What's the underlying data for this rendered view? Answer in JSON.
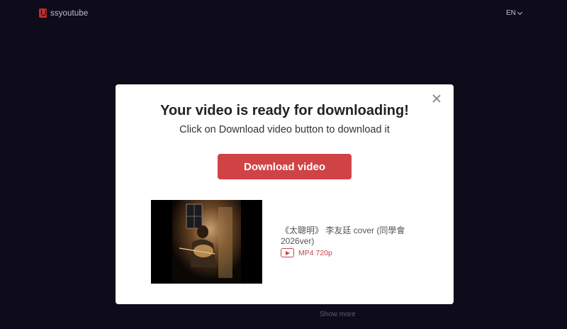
{
  "header": {
    "logo_text": "ssyoutube",
    "language": "EN"
  },
  "modal": {
    "title": "Your video is ready for downloading!",
    "subtitle": "Click on Download video button to download it",
    "download_label": "Download video",
    "video": {
      "title": "《太聰明》 李友廷 cover (同學會2026ver)",
      "format": "MP4 720p"
    }
  },
  "footer": {
    "show_more": "Show more"
  },
  "colors": {
    "background": "#0e0c1b",
    "accent": "#cf4347"
  }
}
